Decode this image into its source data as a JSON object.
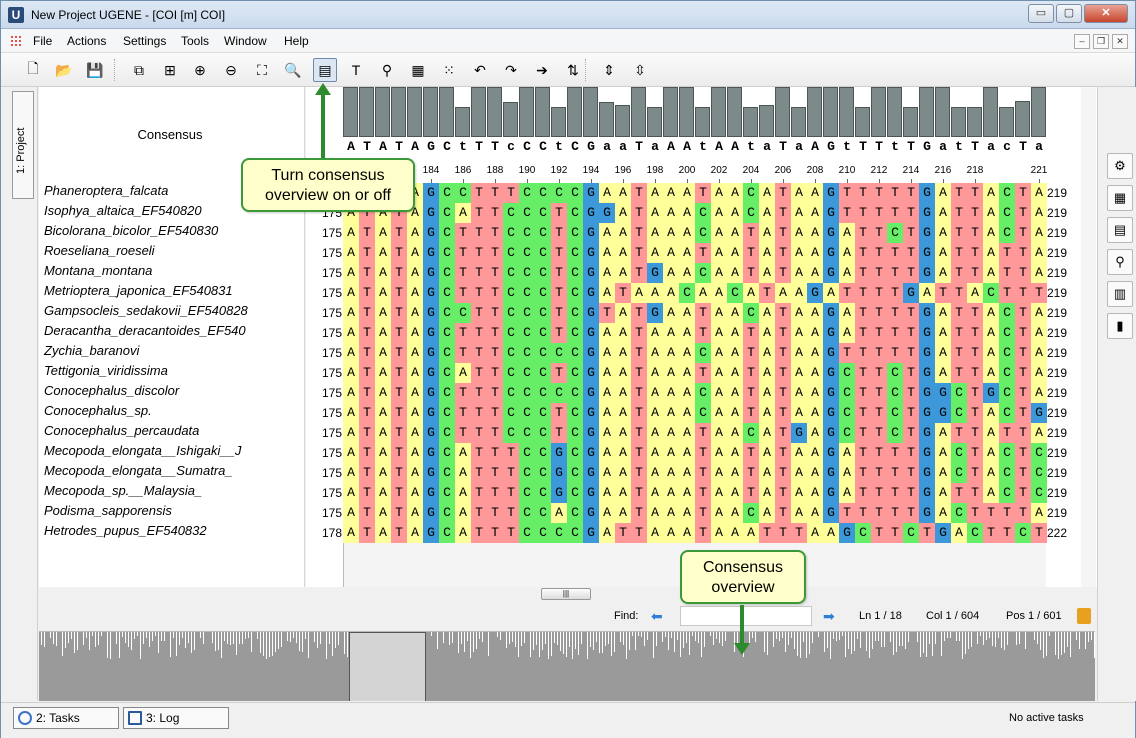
{
  "window": {
    "title": "New Project UGENE - [COI [m] COI]",
    "app_icon_letter": "U",
    "controls": {
      "minimize": "▭",
      "maximize": "▢",
      "close": "✕"
    }
  },
  "menu": [
    "File",
    "Actions",
    "Settings",
    "Tools",
    "Window",
    "Help"
  ],
  "mdi_controls": {
    "minimize": "–",
    "restore": "❐",
    "close": "✕"
  },
  "toolbar": {
    "buttons": [
      {
        "name": "new-project-icon",
        "glyph": "🗋"
      },
      {
        "name": "open-folder-icon",
        "glyph": "📂"
      },
      {
        "name": "save-icon",
        "glyph": "💾"
      },
      {
        "name": "copy-sequence-icon",
        "glyph": "⧉"
      },
      {
        "name": "add-sequence-icon",
        "glyph": "⊞"
      },
      {
        "name": "zoom-in-icon",
        "glyph": "⊕"
      },
      {
        "name": "zoom-out-icon",
        "glyph": "⊖"
      },
      {
        "name": "zoom-fit-icon",
        "glyph": "⛶"
      },
      {
        "name": "reset-zoom-icon",
        "glyph": "🔍"
      },
      {
        "name": "consensus-overview-toggle-icon",
        "glyph": "▤",
        "active": true
      },
      {
        "name": "text-annotation-icon",
        "glyph": "T"
      },
      {
        "name": "tree-icon",
        "glyph": "⚲"
      },
      {
        "name": "build-tree-icon",
        "glyph": "▦"
      },
      {
        "name": "grid-icon",
        "glyph": "⁙"
      },
      {
        "name": "undo-icon",
        "glyph": "↶"
      },
      {
        "name": "redo-icon",
        "glyph": "↷"
      },
      {
        "name": "go-icon",
        "glyph": "➔"
      },
      {
        "name": "sort-icon",
        "glyph": "⇅"
      },
      {
        "name": "expand-rows-icon",
        "glyph": "⇕"
      },
      {
        "name": "collapse-rows-icon",
        "glyph": "⇳"
      }
    ]
  },
  "left_dock": {
    "project_tab": "1: Project"
  },
  "names_panel": {
    "consensus_label": "Consensus",
    "sequences": [
      "Phaneroptera_falcata",
      "Isophya_altaica_EF540820",
      "Bicolorana_bicolor_EF540830",
      "Roeseliana_roeseli",
      "Montana_montana",
      "Metrioptera_japonica_EF540831",
      "Gampsocleis_sedakovii_EF540828",
      "Deracantha_deracantoides_EF540",
      "Zychia_baranovi",
      "Tettigonia_viridissima",
      "Conocephalus_discolor",
      "Conocephalus_sp.",
      "Conocephalus_percaudata",
      "Mecopoda_elongata__Ishigaki__J",
      "Mecopoda_elongata__Sumatra_",
      "Mecopoda_sp.__Malaysia_",
      "Podisma_sapporensis",
      "Hetrodes_pupus_EF540832"
    ]
  },
  "alignment": {
    "consensus": "ATATAGCtTTcCCtCGaaTaAAtAAtaTaAGtTTtTGatTacTa",
    "ruler": [
      "182",
      "184",
      "186",
      "188",
      "190",
      "192",
      "194",
      "196",
      "198",
      "200",
      "202",
      "204",
      "206",
      "208",
      "210",
      "212",
      "214",
      "216",
      "218",
      "221"
    ],
    "start_positions": [
      "175",
      "175",
      "175",
      "175",
      "175",
      "175",
      "175",
      "175",
      "175",
      "175",
      "175",
      "175",
      "175",
      "175",
      "175",
      "175",
      "175",
      "178"
    ],
    "end_positions": [
      "219",
      "219",
      "219",
      "219",
      "219",
      "219",
      "219",
      "219",
      "219",
      "219",
      "219",
      "219",
      "219",
      "219",
      "219",
      "219",
      "219",
      "222"
    ],
    "rows": [
      "ATATAGCCTTTCCCCGAATAAATAACATAAGTTTTTGATTACTA",
      "ATATAGCATTCCCTCGGATAAACAACATAAGTTTTTGATTACTA",
      "ATATAGCTTTCCCTCGAATAAACAATATAAGATTCTGATTACTA",
      "ATATAGCTTTCCCTCGAATAAATAATATAAGATTTTGATTATTA",
      "ATATAGCTTTCCCTCGAATGAACAATATAAGATTTTGATTATTA",
      "ATATAGCTTTCCCTCGATAAACAACATAAGATTTTGATTACTTT",
      "ATATAGCCTTCCCTCGTATGAATAACATAAGATTTTGATTACTA",
      "ATATAGCTTTCCCTCGAATAAATAATATAAGATTTTGATTACTA",
      "ATATAGCTTTCCCCCGAATAAACAATATAAGTTTTTGATTACTA",
      "ATATAGCATTCCCTCGAATAAATAATATAAGCTTCTGATTACTA",
      "ATATAGCTTTCCCCCGAATAAACAATATAAGCTTCTGGCTGCTA",
      "ATATAGCTTTCCCTCGAATAAACAATATAAGCTTCTGGCTACTG",
      "ATATAGCTTTCCCTCGAATAAATAACATGAGCTTCTGATTATTA",
      "ATATAGCATTTCCGCGAATAAATAATATAAGATTTTGACTACTC",
      "ATATAGCATTTCCGCGAATAAATAATATAAGATTTTGACTACTC",
      "ATATAGCATTTCCGCGAATAAATAATATAAGATTTTGATTACTC",
      "ATATAGCATTTCCACGAATAAATAACATAAGTTTTTGACTTTTA",
      "ATATAGCATTTCCCCGATTAAATAAATTTAAGCTTCTGACTTCT"
    ],
    "conservation": [
      50,
      50,
      50,
      50,
      50,
      50,
      50,
      30,
      50,
      50,
      35,
      50,
      50,
      30,
      50,
      50,
      35,
      32,
      50,
      30,
      50,
      50,
      30,
      50,
      50,
      30,
      32,
      50,
      30,
      50,
      50,
      50,
      30,
      50,
      50,
      30,
      50,
      50,
      30,
      30,
      50,
      30,
      36,
      50
    ],
    "colors": {
      "A": "#ffff99",
      "T": "#ff9999",
      "G": "#ff9999",
      "C": "#66ee66",
      "G2": "#3c98d8"
    }
  },
  "status": {
    "find_label": "Find:",
    "ln": "Ln 1 / 18",
    "col": "Col 1 / 604",
    "pos": "Pos 1 / 601"
  },
  "callouts": {
    "top": "Turn consensus\noverview on or off",
    "bottom": "Consensus\noverview"
  },
  "bottom_bar": {
    "tasks_tab": "2: Tasks",
    "log_tab": "3: Log",
    "no_tasks": "No active tasks"
  }
}
